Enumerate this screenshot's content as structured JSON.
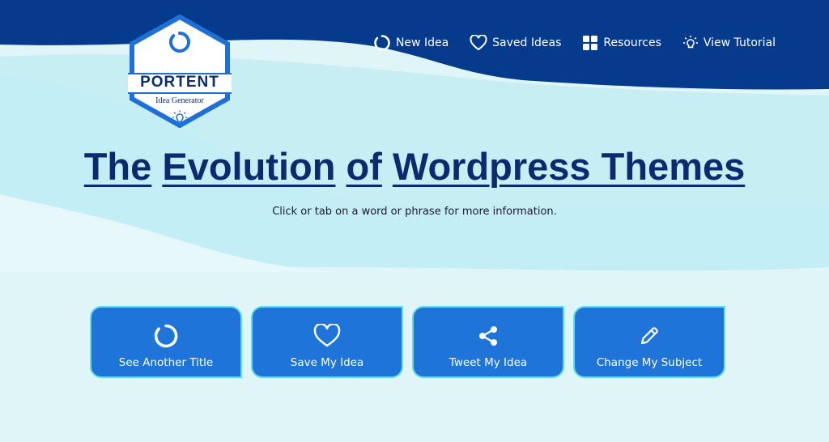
{
  "colors": {
    "header_navy": "#053a8c",
    "accent_blue": "#1e74d9",
    "title_navy": "#0b2a6f",
    "button_border": "#5fe0e8",
    "bg_light": "#dff5f7"
  },
  "logo": {
    "title": "PORTENT",
    "subtitle": "Idea Generator",
    "icons": [
      "portent-ring-icon",
      "lightbulb-icon"
    ]
  },
  "nav": {
    "items": [
      {
        "label": "New Idea",
        "icon": "refresh-ring-icon"
      },
      {
        "label": "Saved Ideas",
        "icon": "heart-icon"
      },
      {
        "label": "Resources",
        "icon": "grid-icon"
      },
      {
        "label": "View Tutorial",
        "icon": "lightbulb-icon"
      }
    ]
  },
  "headline": {
    "words": [
      "The",
      "Evolution",
      "of",
      "Wordpress Themes"
    ],
    "hint": "Click or tab on a word or phrase for more information."
  },
  "actions": [
    {
      "label": "See Another Title",
      "icon": "refresh-ring-icon"
    },
    {
      "label": "Save My Idea",
      "icon": "heart-icon"
    },
    {
      "label": "Tweet My Idea",
      "icon": "share-icon"
    },
    {
      "label": "Change My Subject",
      "icon": "pencil-icon"
    }
  ]
}
